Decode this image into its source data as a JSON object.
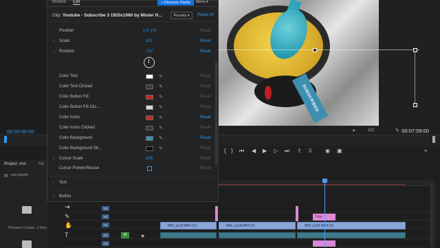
{
  "panel": {
    "tabs": [
      "Browse",
      "Edit"
    ],
    "discover_label": "+ Discover Packs",
    "menu_label": "Menu",
    "clip_prefix": "Clip:",
    "clip_name": "Youtube - Subscribe 3 1920x1080 by Mister H...",
    "presets_label": "Presets",
    "reset_all_label": "Reset All"
  },
  "properties": [
    {
      "name": "Position",
      "value": "x 0, y 0",
      "reset": "Reset",
      "reset_active": false
    },
    {
      "name": "Scale",
      "value": "107",
      "reset": "Reset",
      "reset_active": true
    },
    {
      "name": "Rotation",
      "value": "-21°",
      "reset": "Reset",
      "reset_active": true
    },
    {
      "name": "Color Text",
      "swatch": "#ffffff",
      "reset": "Reset",
      "reset_active": false
    },
    {
      "name": "Color Text Clicked",
      "swatch": "#3c3c3c",
      "reset": "Reset",
      "reset_active": false
    },
    {
      "name": "Color Button Fill",
      "swatch": "#c4291f",
      "reset": "Reset",
      "reset_active": false
    },
    {
      "name": "Color Button Fill Clic...",
      "swatch": "#d9d9d9",
      "reset": "Reset",
      "reset_active": false
    },
    {
      "name": "Color Icons",
      "swatch": "#c4291f",
      "reset": "Reset",
      "reset_active": true
    },
    {
      "name": "Color Icons Clicked",
      "swatch": "#3c3c3c",
      "reset": "Reset",
      "reset_active": false
    },
    {
      "name": "Color Background",
      "swatch": "#3d8fb0",
      "reset": "Reset",
      "reset_active": true
    },
    {
      "name": "Color Background Str...",
      "swatch": "#0f0f0f",
      "reset": "Reset",
      "reset_active": false
    },
    {
      "name": "Cursor Scale",
      "value": "100",
      "reset": "Reset",
      "reset_active": false
    },
    {
      "name": "Cursor Pointer/Mouse",
      "checkbox": true,
      "reset": "Reset",
      "reset_active": false
    }
  ],
  "groups": [
    "Text",
    "Button"
  ],
  "monitor": {
    "timecode_left": "00:00:00:00",
    "timecode_right": "00:07:59:00",
    "fraction": "1/2",
    "sticker_text": "SUBSCRIBED"
  },
  "project": {
    "tab": "Project: nnn",
    "tab2": "Me",
    "file": "nnn.prproj",
    "folder_label": "Premiere Compo...",
    "folder_count": "1 Item"
  },
  "timeline": {
    "tracks": [
      "V3",
      "V2",
      "V1",
      "A1",
      "A2"
    ],
    "clips": [
      "MW_a118.MP4 [V]",
      "MW_a118.MP4 [V]",
      "MW_a118.MP4 [V]"
    ],
    "pink_label": "Tittle"
  },
  "colors": {
    "accent": "#2e9cf1",
    "discover": "#1473e6"
  }
}
